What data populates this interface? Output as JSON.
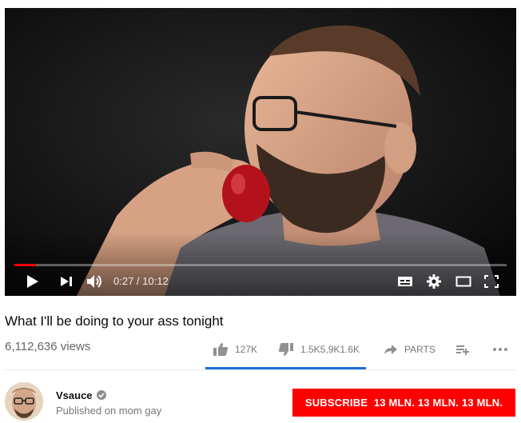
{
  "player": {
    "current_time": "0:27",
    "separator": " / ",
    "duration": "10:12",
    "progress_fraction": 0.044,
    "progress_color": "#ff0000",
    "icons": [
      "play-icon",
      "next-icon",
      "volume-icon",
      "subtitles-icon",
      "settings-icon",
      "theater-mode-icon",
      "fullscreen-icon"
    ]
  },
  "video": {
    "title": "What I'll be doing to your ass tonight",
    "views": "6,112,636 views"
  },
  "actions": {
    "likes": "127K",
    "dislikes": "1.5K5,9K1.6K",
    "share": "PARTS",
    "like_fraction": 0.0,
    "sentiment_color": "#1d6ecf",
    "icons": [
      "thumbs-up-icon",
      "thumbs-down-icon",
      "share-arrow-icon",
      "add-to-playlist-icon",
      "more-icon"
    ]
  },
  "channel": {
    "name": "Vsauce",
    "published": "Published on mom gay",
    "subscribe_label": "SUBSCRIBE  13 MLN. 13 MLN. 13 MLN.",
    "subscribe_color": "#ff0000"
  }
}
